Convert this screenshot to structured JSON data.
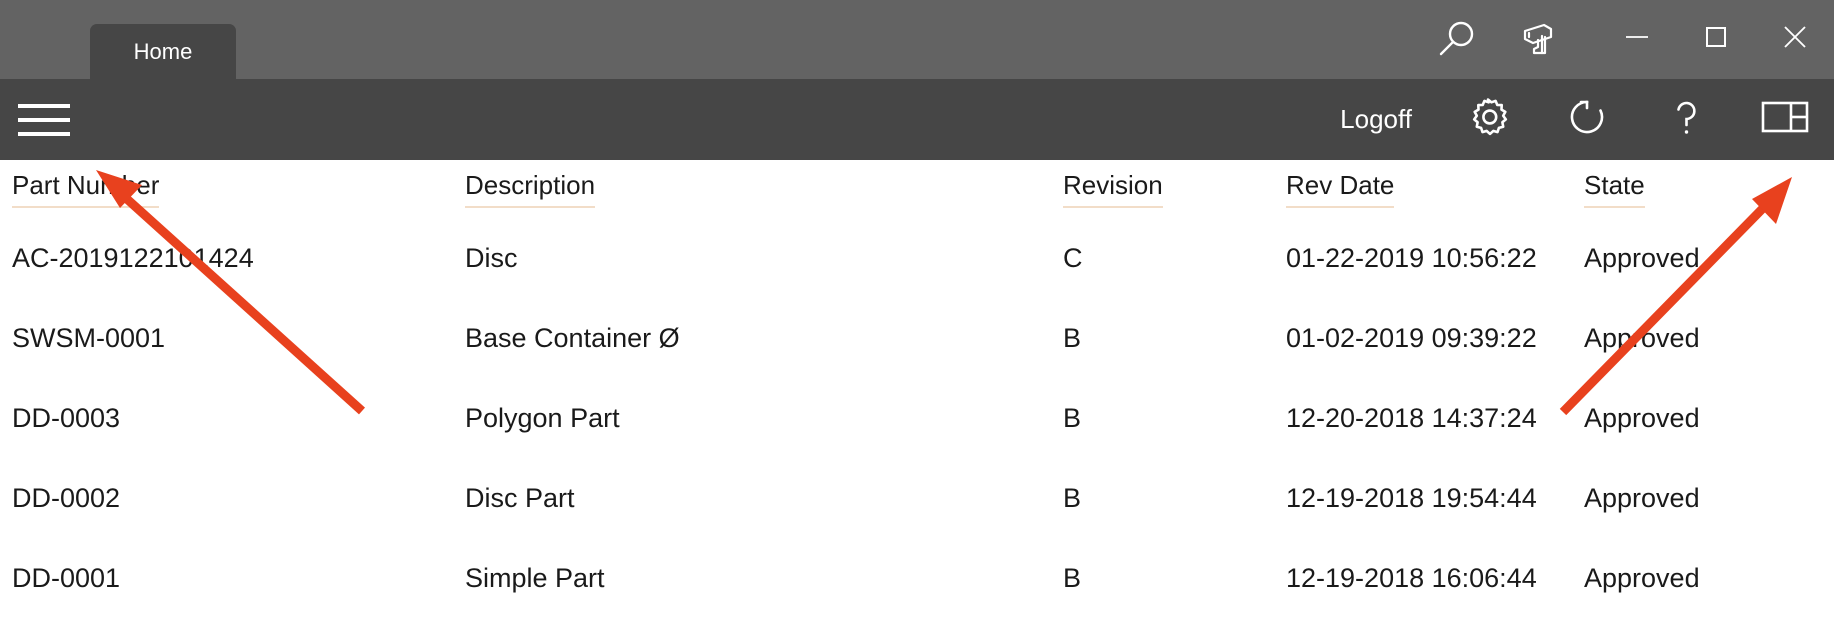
{
  "window": {
    "tab_label": "Home",
    "title_icons": [
      {
        "name": "search-icon",
        "label": "Search"
      },
      {
        "name": "barcode-scanner-icon",
        "label": "Barcode Scanner"
      }
    ],
    "controls": {
      "minimize": "Minimize",
      "maximize": "Maximize",
      "close": "Close"
    }
  },
  "toolbar": {
    "menu_label": "Menu",
    "logoff_label": "Logoff",
    "icons": [
      {
        "name": "gear-icon",
        "label": "Settings"
      },
      {
        "name": "refresh-icon",
        "label": "Refresh"
      },
      {
        "name": "help-icon",
        "label": "Help"
      },
      {
        "name": "layout-panel-icon",
        "label": "Layout"
      }
    ]
  },
  "table": {
    "columns": [
      "Part Number",
      "Description",
      "Revision",
      "Rev Date",
      "State"
    ],
    "rows": [
      {
        "part_number": "AC-2019122101424",
        "description": "Disc",
        "revision": "C",
        "rev_date": "01-22-2019 10:56:22",
        "state": "Approved"
      },
      {
        "part_number": "SWSM-0001",
        "description": "Base Container Ø",
        "revision": "B",
        "rev_date": "01-02-2019 09:39:22",
        "state": "Approved"
      },
      {
        "part_number": "DD-0003",
        "description": "Polygon Part",
        "revision": "B",
        "rev_date": "12-20-2018 14:37:24",
        "state": "Approved"
      },
      {
        "part_number": "DD-0002",
        "description": "Disc Part",
        "revision": "B",
        "rev_date": "12-19-2018 19:54:44",
        "state": "Approved"
      },
      {
        "part_number": "DD-0001",
        "description": "Simple Part",
        "revision": "B",
        "rev_date": "12-19-2018 16:06:44",
        "state": "Approved"
      }
    ]
  },
  "annotations": {
    "color": "#e8411e",
    "arrows": [
      {
        "name": "arrow-to-menu-icon",
        "points_to": "menu-button"
      },
      {
        "name": "arrow-to-layout-icon",
        "points_to": "layout-panel-button"
      }
    ]
  },
  "colors": {
    "titlebar": "#636363",
    "toolbar": "#464646",
    "content": "#ffffff",
    "text": "#1a1a1a",
    "header_underline": "#f2ddc8",
    "annotation": "#e8411e"
  }
}
